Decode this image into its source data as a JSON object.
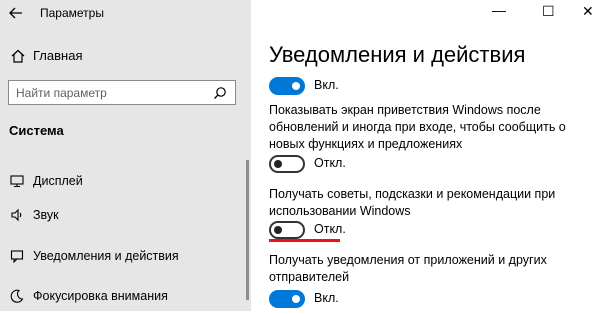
{
  "window": {
    "title": "Параметры",
    "controls": {
      "minimize": "—",
      "maximize": "☐",
      "close": "✕"
    }
  },
  "nav": {
    "home_label": "Главная",
    "search": {
      "placeholder": "Найти параметр"
    },
    "section": "Система",
    "items": [
      {
        "label": "Дисплей",
        "icon": "display-icon"
      },
      {
        "label": "Звук",
        "icon": "speaker-icon"
      },
      {
        "label": "Уведомления и действия",
        "icon": "notification-icon"
      },
      {
        "label": "Фокусировка внимания",
        "icon": "moon-icon"
      }
    ]
  },
  "main": {
    "title": "Уведомления и действия",
    "settings": [
      {
        "description": "",
        "state": "Вкл.",
        "on": true
      },
      {
        "description": "Показывать экран приветствия Windows после обновлений и иногда при входе, чтобы сообщить о новых функциях и предложениях",
        "state": "Откл.",
        "on": false
      },
      {
        "description": "Получать советы, подсказки и рекомендации при использовании Windows",
        "state": "Откл.",
        "on": false,
        "highlighted": true
      },
      {
        "description": "Получать уведомления от приложений и других отправителей",
        "state": "Вкл.",
        "on": true
      }
    ]
  },
  "colors": {
    "accent": "#0078d7",
    "highlight": "#e8141c",
    "nav_bg": "#e6e6e6"
  }
}
